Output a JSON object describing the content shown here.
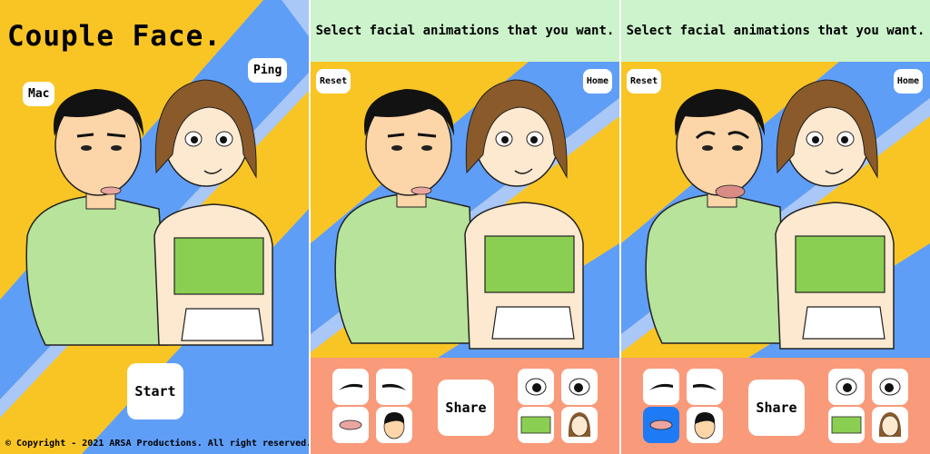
{
  "splash": {
    "title": "Couple Face.",
    "bubble_left": "Mac",
    "bubble_right": "Ping",
    "start_label": "Start",
    "copyright": "© Copyright - 2021 ARSA Productions. All right reserved."
  },
  "editor": {
    "header": "Select facial animations that you want.",
    "reset_label": "Reset",
    "home_label": "Home",
    "share_label": "Share"
  },
  "colors": {
    "yellow": "#f9c525",
    "blue": "#5f9ef7",
    "light_blue": "#a9c7f7",
    "header_green": "#ccf3cc",
    "controls_salmon": "#f99a7a",
    "active_blue": "#1f7bf5",
    "shirt_green": "#b8e39a",
    "top_green": "#8bcf52",
    "skin_man": "#fcd5a8",
    "skin_woman": "#fde9cf",
    "hair_man": "#121212",
    "hair_woman": "#8a5a2b"
  },
  "icons": [
    "eyebrow-left-icon",
    "eyebrow-right-icon",
    "lips-icon",
    "man-face-icon",
    "eye-left-icon",
    "eye-right-icon",
    "top-icon",
    "woman-face-icon"
  ],
  "panel3_active_control": "lips"
}
